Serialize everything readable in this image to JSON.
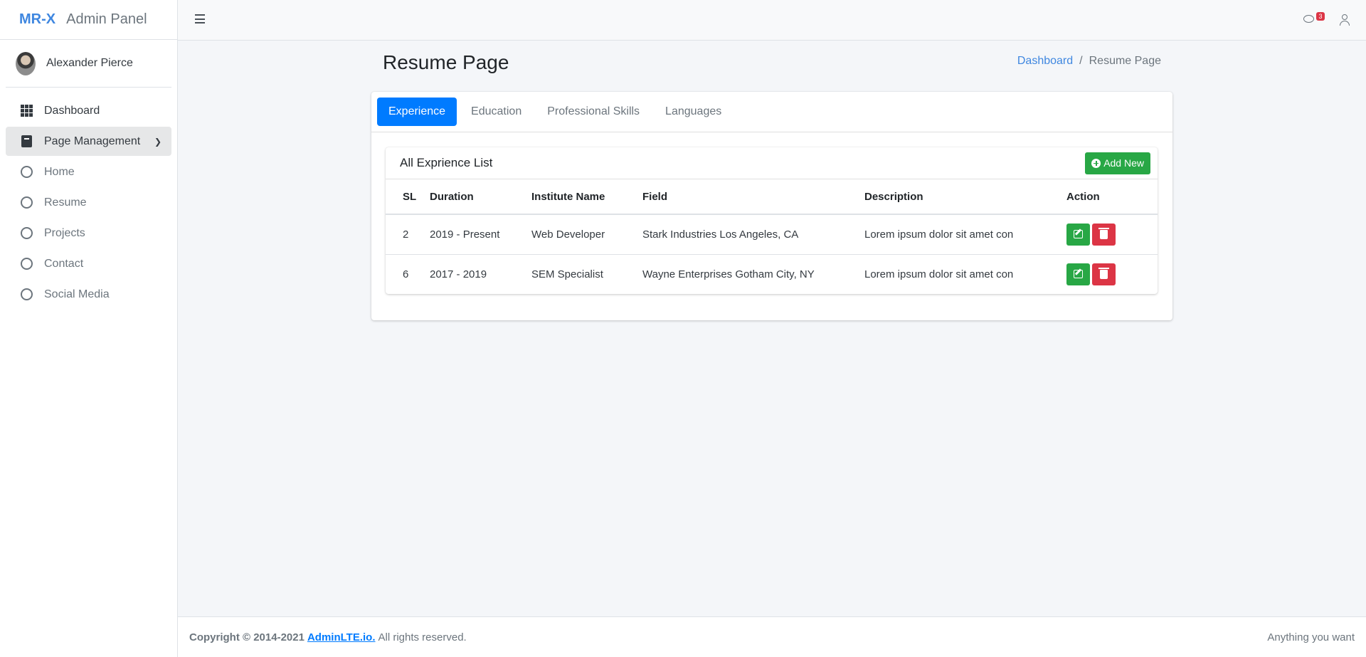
{
  "brand": {
    "logo": "MR-X",
    "name": "Admin Panel"
  },
  "user": {
    "name": "Alexander Pierce"
  },
  "sidebar": {
    "items": [
      {
        "label": "Dashboard",
        "icon": "grid-icon"
      },
      {
        "label": "Page Management",
        "icon": "book-icon"
      },
      {
        "label": "Home",
        "icon": "circle-icon"
      },
      {
        "label": "Resume",
        "icon": "circle-icon"
      },
      {
        "label": "Projects",
        "icon": "circle-icon"
      },
      {
        "label": "Contact",
        "icon": "circle-icon"
      },
      {
        "label": "Social Media",
        "icon": "circle-icon"
      }
    ]
  },
  "topbar": {
    "chat_badge": "3"
  },
  "page": {
    "title": "Resume Page",
    "breadcrumb": {
      "home": "Dashboard",
      "separator": "/",
      "current": "Resume Page"
    }
  },
  "tabs": [
    "Experience",
    "Education",
    "Professional Skills",
    "Languages"
  ],
  "list": {
    "title": "All Exprience List",
    "add_label": "Add New",
    "columns": [
      "SL",
      "Duration",
      "Institute Name",
      "Field",
      "Description",
      "Action"
    ],
    "rows": [
      [
        "2",
        "2019 - Present",
        "Web Developer",
        "Stark Industries Los Angeles, CA",
        "Lorem ipsum dolor sit amet con"
      ],
      [
        "6",
        "2017 - 2019",
        "SEM Specialist",
        "Wayne Enterprises Gotham City, NY",
        "Lorem ipsum dolor sit amet con"
      ]
    ]
  },
  "footer": {
    "copyright": "Copyright © 2014-2021",
    "link": "AdminLTE.io.",
    "rest": "All rights reserved.",
    "right": "Anything you want"
  },
  "colors": {
    "primary": "#007bff",
    "success": "#28a745",
    "danger": "#dc3545",
    "brand": "#3f87e0"
  }
}
